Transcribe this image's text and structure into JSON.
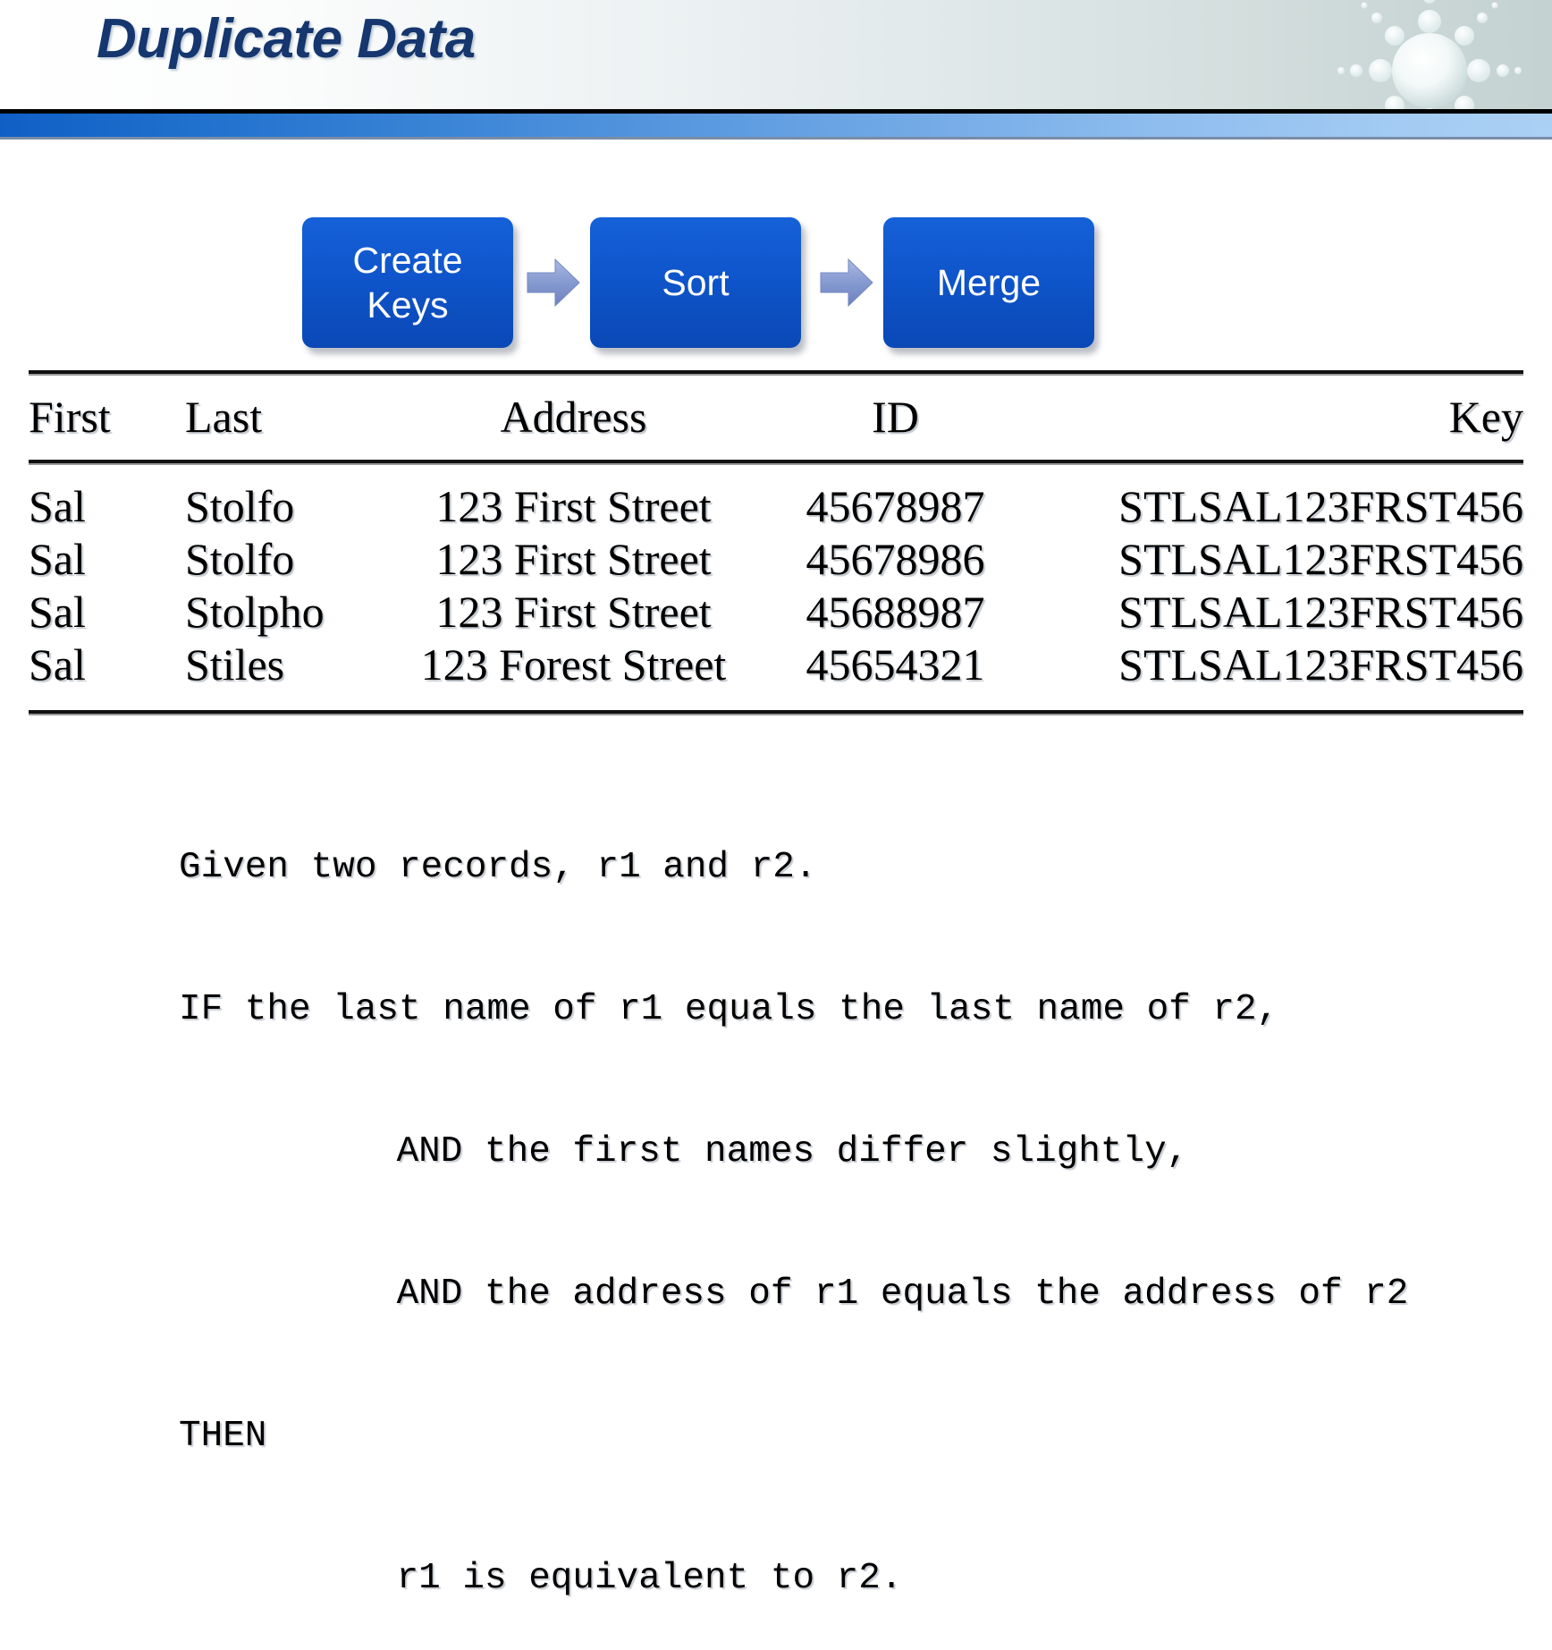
{
  "header": {
    "title": "Duplicate Data",
    "decoration": "starburst-icon",
    "title_color": "#15366e",
    "accent_bar_start_color": "#0f5fc6",
    "accent_bar_end_color": "#abd0f4"
  },
  "flow": {
    "steps": [
      {
        "label": "Create\nKeys",
        "line1": "Create",
        "line2": "Keys"
      },
      {
        "label": "Sort",
        "line1": "Sort",
        "line2": ""
      },
      {
        "label": "Merge",
        "line1": "Merge",
        "line2": ""
      }
    ],
    "arrows": [
      "right-arrow-icon",
      "right-arrow-icon"
    ],
    "box_color": "#0f55cb",
    "arrow_color": "#8093cc"
  },
  "table": {
    "columns": [
      "First",
      "Last",
      "Address",
      "ID",
      "Key"
    ],
    "rows": [
      [
        "Sal",
        "Stolfo",
        "123 First Street",
        "45678987",
        "STLSAL123FRST456"
      ],
      [
        "Sal",
        "Stolfo",
        "123 First Street",
        "45678986",
        "STLSAL123FRST456"
      ],
      [
        "Sal",
        "Stolpho",
        "123 First Street",
        "45688987",
        "STLSAL123FRST456"
      ],
      [
        "Sal",
        "Stiles",
        "123 Forest Street",
        "45654321",
        "STLSAL123FRST456"
      ]
    ]
  },
  "rule_text": {
    "lines": [
      {
        "text": "Given two records, r1 and r2.",
        "indent": 0
      },
      {
        "text": "IF the last name of r1 equals the last name of r2,",
        "indent": 0
      },
      {
        "text": "AND the first names differ slightly,",
        "indent": 1
      },
      {
        "text": "AND the address of r1 equals the address of r2",
        "indent": 1
      },
      {
        "text": "THEN",
        "indent": 0
      },
      {
        "text": "r1 is equivalent to r2.",
        "indent": 1
      }
    ]
  }
}
